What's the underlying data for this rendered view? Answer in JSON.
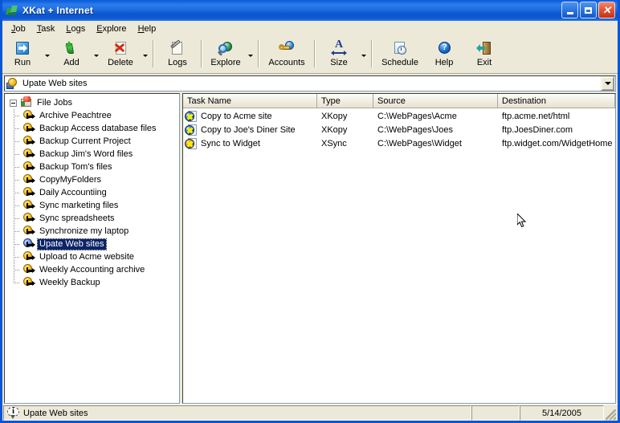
{
  "window": {
    "title": "XKat + Internet",
    "app_icon": "xkat-app-icon",
    "caption": {
      "minimize_label": "_",
      "maximize_label": "□",
      "close_label": "✕"
    }
  },
  "menubar": {
    "items": [
      {
        "label": "Job"
      },
      {
        "label": "Task"
      },
      {
        "label": "Logs"
      },
      {
        "label": "Explore"
      },
      {
        "label": "Help"
      }
    ]
  },
  "toolbar": {
    "buttons": [
      {
        "label": "Run",
        "icon": "run-icon",
        "has_dropdown": true
      },
      {
        "label": "Add",
        "icon": "add-icon",
        "has_dropdown": true
      },
      {
        "label": "Delete",
        "icon": "delete-icon",
        "has_dropdown": true
      },
      {
        "label": "Logs",
        "icon": "logs-icon",
        "has_dropdown": false
      },
      {
        "label": "Explore",
        "icon": "explore-icon",
        "has_dropdown": true
      },
      {
        "label": "Accounts",
        "icon": "accounts-icon",
        "has_dropdown": false
      },
      {
        "label": "Size",
        "icon": "size-icon",
        "has_dropdown": true
      },
      {
        "label": "Schedule",
        "icon": "schedule-icon",
        "has_dropdown": false
      },
      {
        "label": "Help",
        "icon": "help-icon",
        "has_dropdown": false
      },
      {
        "label": "Exit",
        "icon": "exit-icon",
        "has_dropdown": false
      }
    ],
    "help_glyph": "?"
  },
  "combobar": {
    "value": "Upate Web sites",
    "icon": "job-icon",
    "dropdown_icon": "chevron-down-icon"
  },
  "tree": {
    "root": {
      "label": "File Jobs",
      "expanded": true,
      "icon": "file-jobs-icon"
    },
    "items": [
      {
        "label": "Archive Peachtree",
        "selected": false
      },
      {
        "label": "Backup Access database files",
        "selected": false
      },
      {
        "label": "Backup Current Project",
        "selected": false
      },
      {
        "label": "Backup Jim's Word files",
        "selected": false
      },
      {
        "label": "Backup Tom's files",
        "selected": false
      },
      {
        "label": "CopyMyFolders",
        "selected": false
      },
      {
        "label": "Daily Accountiing",
        "selected": false
      },
      {
        "label": "Sync marketing files",
        "selected": false
      },
      {
        "label": "Sync spreadsheets",
        "selected": false
      },
      {
        "label": "Synchronize my laptop",
        "selected": false
      },
      {
        "label": "Upate Web sites",
        "selected": true
      },
      {
        "label": "Upload to Acme website",
        "selected": false
      },
      {
        "label": "Weekly Accounting archive",
        "selected": false
      },
      {
        "label": "Weekly Backup",
        "selected": false
      }
    ]
  },
  "list": {
    "columns": [
      "Task Name",
      "Type",
      "Source",
      "Destination"
    ],
    "rows": [
      {
        "icon": "task-xkopy-icon",
        "name": "Copy to Acme site",
        "type": "XKopy",
        "source": "C:\\WebPages\\Acme",
        "destination": "ftp.acme.net/html"
      },
      {
        "icon": "task-xkopy-icon",
        "name": "Copy to Joe's Diner Site",
        "type": "XKopy",
        "source": "C:\\WebPages\\Joes",
        "destination": "ftp.JoesDiner.com"
      },
      {
        "icon": "task-xsync-icon",
        "name": "Sync to Widget",
        "type": "XSync",
        "source": "C:\\WebPages\\Widget",
        "destination": "ftp.widget.com/WidgetHome"
      }
    ]
  },
  "statusbar": {
    "message": "Upate Web sites",
    "middle": "",
    "date": "5/14/2005",
    "info_icon": "info-icon",
    "info_glyph": "i",
    "grip_icon": "resize-grip-icon"
  },
  "colors": {
    "titlebar_blue": "#0a56d6",
    "window_face": "#ece9d8",
    "selection_blue": "#0a246a",
    "border_blue": "#7f9db9"
  }
}
